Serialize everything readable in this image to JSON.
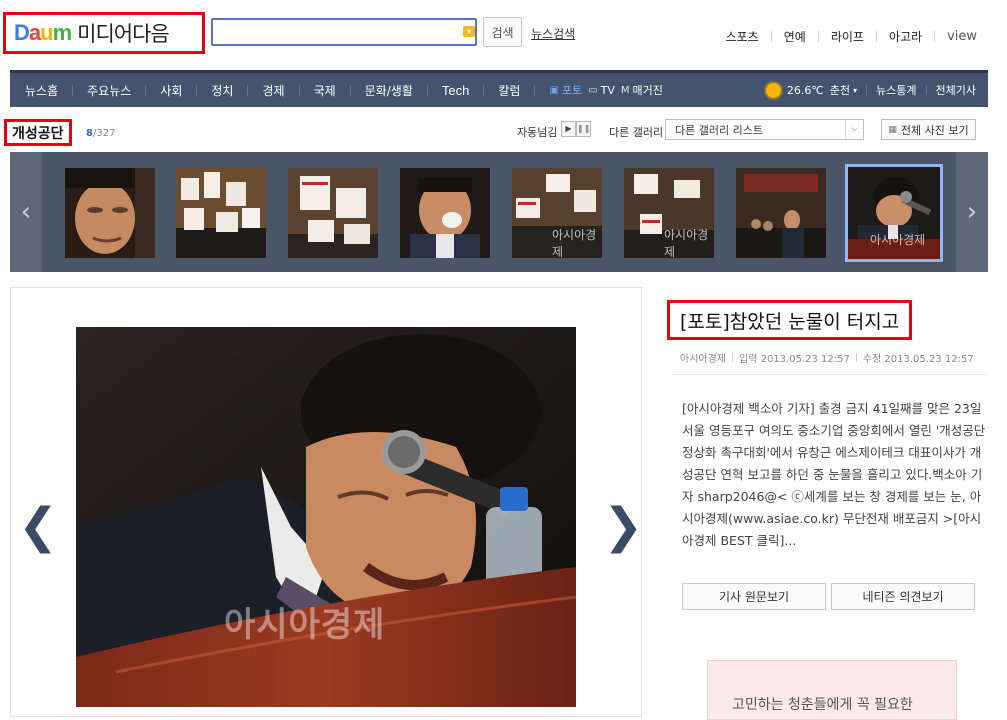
{
  "header": {
    "logo_letters": [
      "D",
      "a",
      "u",
      "m"
    ],
    "logo_colors": [
      "#3e7ce0",
      "#ed3d3d",
      "#f7b500",
      "#3cb73c"
    ],
    "service_name": "미디어다음",
    "search_placeholder": "",
    "search_button": "검색",
    "news_search_link": "뉴스검색",
    "top_links": [
      "스포츠",
      "연예",
      "라이프",
      "아고라"
    ],
    "view_link": "view"
  },
  "nav": {
    "items": [
      "뉴스홈",
      "주요뉴스",
      "사회",
      "정치",
      "경제",
      "국제",
      "문화/생활",
      "Tech",
      "칼럼"
    ],
    "media": [
      {
        "icon": "camera-icon",
        "label": "포토",
        "active": true
      },
      {
        "icon": "tv-icon",
        "label": "TV",
        "active": false
      },
      {
        "icon": "magazine-icon",
        "label": "매거진",
        "active": false
      }
    ],
    "weather_temp": "26.6℃",
    "weather_city": "춘천",
    "right_links": [
      "뉴스통계",
      "전체기사"
    ]
  },
  "gallery": {
    "title": "개성공단",
    "current": "8",
    "total": "/327",
    "autoplay_label": "자동넘김",
    "other_gallery_label": "다른 갤러리",
    "select_value": "다른 갤러리 리스트",
    "all_photos_label": "전체 사진 보기",
    "thumbnail_count": 8,
    "selected_index": 7,
    "watermark": "아시아경제"
  },
  "article": {
    "title": "[포토]참았던 눈물이 터지고",
    "source": "아시아경제",
    "input_time": "입력 2013.05.23 12:57",
    "edit_time": "수정 2013.05.23 12:57",
    "body": "[아시아경제 백소아 기자] 출경 금지 41일째를 맞은 23일 서울 영등포구 여의도 중소기업 중앙회에서 열린 '개성공단 정상화 촉구대회'에서 유창근 에스제이테크 대표이사가 개성공단 연혁 보고를 하던 중 눈물을 흘리고 있다.백소아 기자 sharp2046@< ⓒ세계를 보는 창 경제를 보는 눈, 아시아경제(www.asiae.co.kr) 무단전재 배포금지 >[아시아경제 BEST 클릭]...",
    "original_button": "기사 원문보기",
    "comment_button": "네티즌 의견보기"
  },
  "ad": {
    "text": "고민하는 청춘들에게 꼭 필요한"
  },
  "colors": {
    "nav_bg": "#44546e",
    "highlight_border": "#e60012",
    "search_border": "#5571d8",
    "photo_arrow": "#3b4a66"
  }
}
